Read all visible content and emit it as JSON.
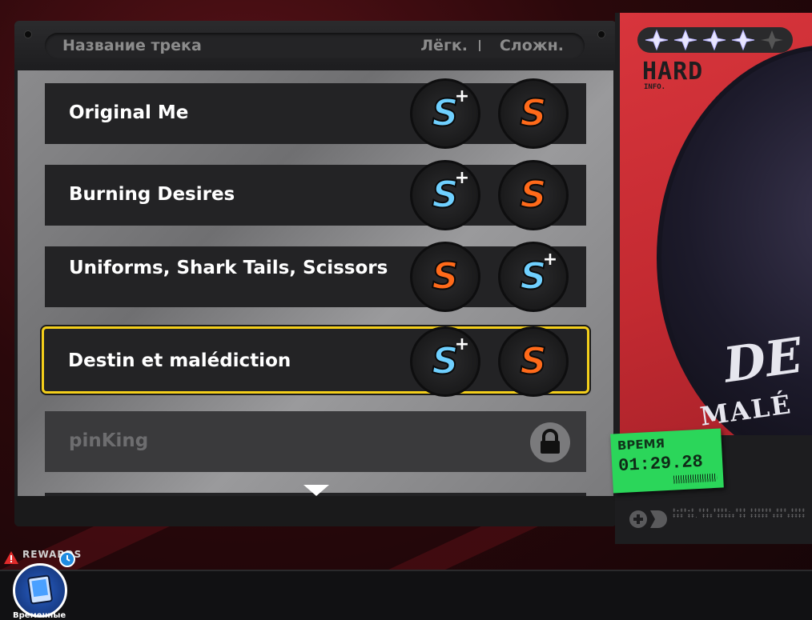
{
  "header": {
    "title": "Название трека",
    "easy_label": "Лёгк.",
    "hard_label": "Сложн."
  },
  "tracks": [
    {
      "name": "Original Me",
      "easy_rank": "S+",
      "hard_rank": "S",
      "selected": false,
      "locked": false
    },
    {
      "name": "Burning Desires",
      "easy_rank": "S+",
      "hard_rank": "S",
      "selected": false,
      "locked": false
    },
    {
      "name": "Uniforms, Shark Tails, Scissors",
      "easy_rank": "S",
      "hard_rank": "S+",
      "selected": false,
      "locked": false
    },
    {
      "name": "Destin et malédiction",
      "easy_rank": "S+",
      "hard_rank": "S",
      "selected": true,
      "locked": false
    },
    {
      "name": "pinKing",
      "easy_rank": "",
      "hard_rank": "",
      "selected": false,
      "locked": true
    }
  ],
  "card": {
    "difficulty": "HARD",
    "difficulty_sub": "INFO.",
    "stars_filled": 4,
    "stars_total": 5,
    "cover_text_line1": "DE",
    "cover_text_line2": "MALÉ",
    "time_label": "ВРЕМЯ",
    "time_value": "01:29.28",
    "footer_text": "ǂ✦ǂǂ✦ǂ ǂǂǂ ǂǂǂǂ. ǂǂǂ ǂǂǂǂǂǂ ǂǂǂ ǂǂǂǂ ǂǂǂ ǂǂ. ǂǂǂ ǂǂǂǂǂ ǂǂ ǂǂǂǂǂ ǂǂǂ ǂǂǂǂǂ"
  },
  "rewards": {
    "arc_label": "REWARDS",
    "label": "Временные"
  },
  "colors": {
    "selected_border": "#f4cf1b",
    "rank_s": "#ff6a1a",
    "rank_s_plus": "#6fd0ff",
    "time_tag": "#2bd65a",
    "card_red": "#d8353c"
  }
}
